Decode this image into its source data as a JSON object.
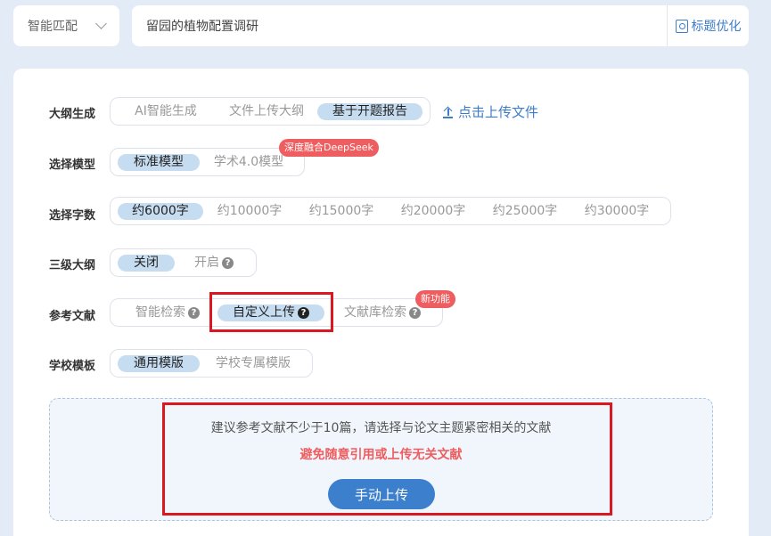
{
  "header": {
    "mode_select": "智能匹配",
    "title_input": "留园的植物配置调研",
    "optimize_label": "标题优化"
  },
  "outline": {
    "label": "大纲生成",
    "options": [
      "AI智能生成",
      "文件上传大纲",
      "基于开题报告"
    ],
    "selected": "基于开题报告",
    "upload_link": "点击上传文件"
  },
  "model": {
    "label": "选择模型",
    "options": [
      "标准模型",
      "学术4.0模型"
    ],
    "selected": "标准模型",
    "badge": "深度融合DeepSeek"
  },
  "word_count": {
    "label": "选择字数",
    "options": [
      "约6000字",
      "约10000字",
      "约15000字",
      "约20000字",
      "约25000字",
      "约30000字"
    ],
    "selected": "约6000字"
  },
  "outline_level3": {
    "label": "三级大纲",
    "options": [
      "关闭",
      "开启"
    ],
    "selected": "关闭"
  },
  "references": {
    "label": "参考文献",
    "options": [
      "智能检索",
      "自定义上传",
      "文献库检索"
    ],
    "selected": "自定义上传",
    "badge": "新功能"
  },
  "template": {
    "label": "学校模板",
    "options": [
      "通用模版",
      "学校专属模版"
    ],
    "selected": "通用模版"
  },
  "upload_panel": {
    "tip": "建议参考文献不少于10篇，请选择与论文主题紧密相关的文献",
    "warning": "避免随意引用或上传无关文献",
    "button": "手动上传"
  },
  "colors": {
    "accent": "#3b7fcd",
    "selected_bg": "#c6dcf0",
    "badge_red": "#ee5d5f",
    "highlight_red": "#d9191f",
    "page_bg": "#e3ecf6"
  }
}
